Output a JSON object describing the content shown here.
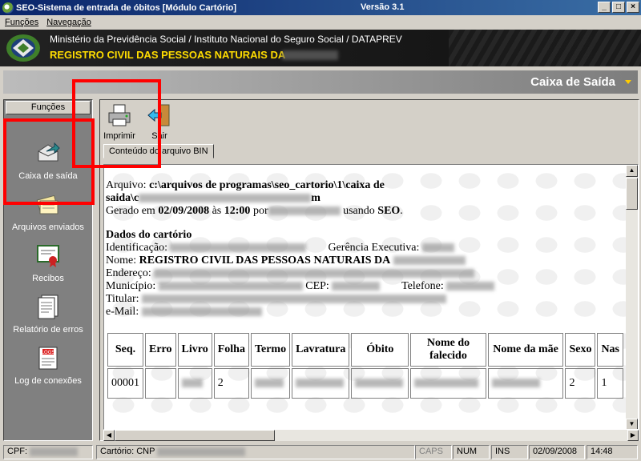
{
  "window": {
    "title": "SEO-Sistema de entrada de óbitos [Módulo Cartório]",
    "version": "Versão 3.1",
    "controls": [
      "_",
      "□",
      "×"
    ]
  },
  "menu": [
    "Funções",
    "Navegação"
  ],
  "banner": {
    "line1": "Ministério da Previdência Social / Instituto Nacional do Seguro Social / DATAPREV",
    "line2": "REGISTRO CIVIL DAS PESSOAS NATURAIS DA"
  },
  "header": {
    "title": "Caixa de Saída"
  },
  "sidebar": {
    "heading": "Funções",
    "items": [
      {
        "label": "Caixa de saída",
        "icon": "outbox-icon"
      },
      {
        "label": "Arquivos enviados",
        "icon": "sent-files-icon"
      },
      {
        "label": "Recibos",
        "icon": "receipt-icon"
      },
      {
        "label": "Relatório de erros",
        "icon": "error-report-icon"
      },
      {
        "label": "Log de conexões",
        "icon": "connection-log-icon"
      }
    ]
  },
  "toolbar": {
    "print_label": "Imprimir",
    "exit_label": "Sair"
  },
  "tabs": [
    "Conteúdo do arquivo BIN"
  ],
  "document": {
    "file_label": "Arquivo:",
    "file_path_1": "c:\\arquivos de programas\\seo_cartorio\\1\\caixa de",
    "file_path_2a": "saida\\c",
    "file_path_2b": "m",
    "generated_prefix": "Gerado em",
    "generated_date": "02/09/2008",
    "generated_at": "às",
    "generated_time": "12:00",
    "generated_by": "por",
    "using": "usando",
    "using_app": "SEO",
    "section_title": "Dados do cartório",
    "ident_label": "Identificação:",
    "gerencia_label": "Gerência Executiva:",
    "nome_label": "Nome:",
    "nome_value": "REGISTRO CIVIL DAS PESSOAS NATURAIS DA",
    "endereco_label": "Endereço:",
    "municipio_label": "Município:",
    "cep_label": "CEP:",
    "telefone_label": "Telefone:",
    "titular_label": "Titular:",
    "email_label": "e-Mail:"
  },
  "table": {
    "headers": [
      "Seq.",
      "Erro",
      "Livro",
      "Folha",
      "Termo",
      "Lavratura",
      "Óbito",
      "Nome do falecido",
      "Nome da mãe",
      "Sexo",
      "Nas"
    ],
    "row1": [
      "00001",
      "",
      "",
      "2",
      "",
      "",
      "",
      "",
      "",
      "2",
      "1"
    ]
  },
  "statusbar": {
    "cpf_label": "CPF:",
    "cartorio_label": "Cartório: CNP",
    "caps": "CAPS",
    "num": "NUM",
    "ins": "INS",
    "date": "02/09/2008",
    "time": "14:48"
  },
  "colors": {
    "titlebar": "#0a246a",
    "banner_text": "#ffdd00",
    "highlight": "#ff0000"
  }
}
